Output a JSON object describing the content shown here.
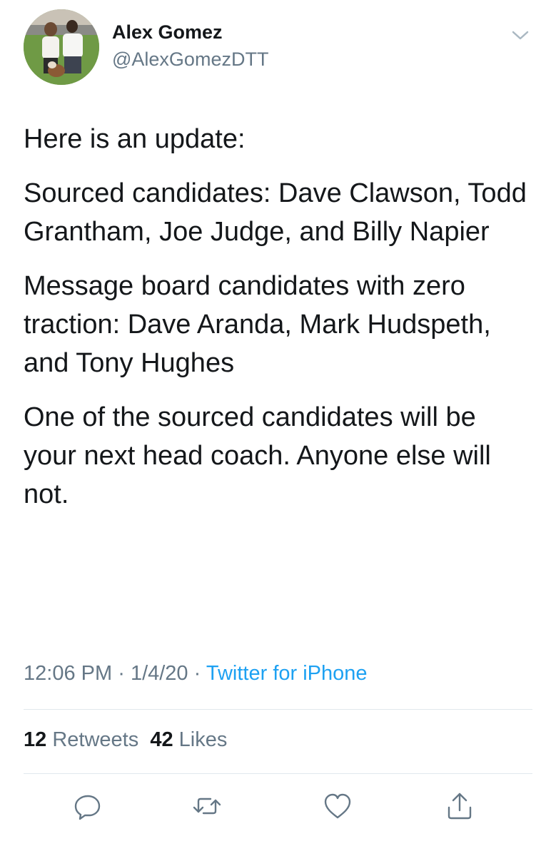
{
  "user": {
    "name": "Alex Gomez",
    "handle": "@AlexGomezDTT"
  },
  "tweet": {
    "paragraphs": [
      "Here is an update:",
      "Sourced candidates: Dave Clawson, Todd Grantham, Joe Judge, and Billy Napier",
      "Message board candidates with zero traction: Dave Aranda, Mark Hudspeth, and Tony Hughes",
      "One of the sourced candidates will be your next head coach. Anyone else will not."
    ],
    "time": "12:06 PM",
    "date": "1/4/20",
    "separator": "·",
    "source": "Twitter for iPhone"
  },
  "stats": {
    "retweets_count": "12",
    "retweets_label": "Retweets",
    "likes_count": "42",
    "likes_label": "Likes"
  },
  "icons": {
    "caret": "chevron-down-icon",
    "reply": "reply-icon",
    "retweet": "retweet-icon",
    "like": "heart-icon",
    "share": "share-icon"
  },
  "colors": {
    "text": "#14171a",
    "secondary": "#657786",
    "link": "#1da1f2",
    "divider": "#e1e8ed"
  }
}
